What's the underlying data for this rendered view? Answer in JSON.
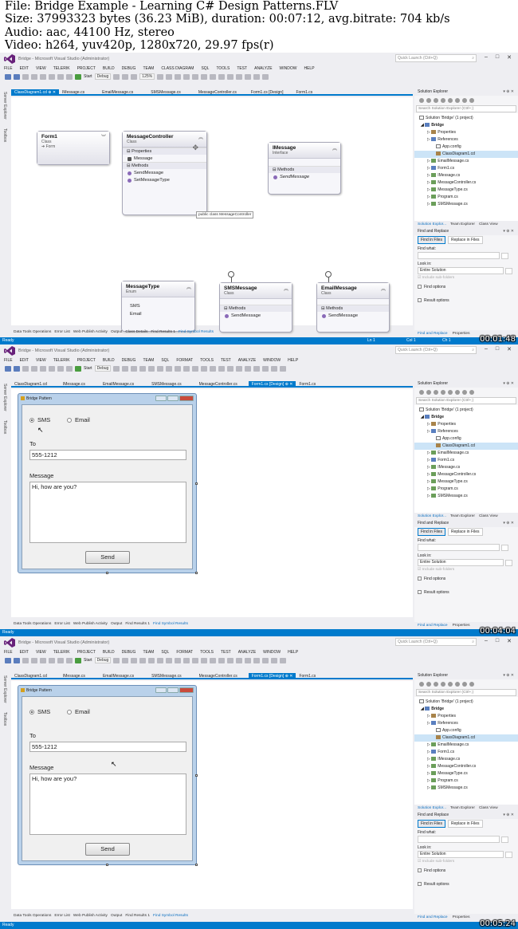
{
  "info": {
    "file": "File: Bridge Example - Learning C# Design Patterns.FLV",
    "size": "Size: 37993323 bytes (36.23 MiB), duration: 00:07:12, avg.bitrate: 704 kb/s",
    "audio": "Audio: aac, 44100 Hz, stereo",
    "video": "Video: h264, yuv420p, 1280x720, 29.97 fps(r)"
  },
  "colors": {
    "accent": "#007acc",
    "status_bar": "#007acc",
    "editor_bg": "#ffffff"
  },
  "window": {
    "title": "Bridge - Microsoft Visual Studio (Administrator)",
    "quick_launch": "Quick Launch (Ctrl+Q)",
    "menu1": [
      "FILE",
      "EDIT",
      "VIEW",
      "TELERIK",
      "PROJECT",
      "BUILD",
      "DEBUG",
      "TEAM",
      "CLASS DIAGRAM",
      "SQL",
      "TOOLS",
      "TEST",
      "ANALYZE",
      "WINDOW",
      "HELP"
    ],
    "menu2": [
      "FILE",
      "EDIT",
      "VIEW",
      "TELERIK",
      "PROJECT",
      "BUILD",
      "DEBUG",
      "TEAM",
      "SQL",
      "FORMAT",
      "TOOLS",
      "TEST",
      "ANALYZE",
      "WINDOW",
      "HELP"
    ],
    "start": "Start",
    "config": "Debug",
    "zoom": "125%",
    "left_tabs": [
      "Server Explorer",
      "Toolbox"
    ]
  },
  "frame1": {
    "tabs": [
      "ClassDiagram1.cd",
      "IMessage.cs",
      "EmailMessage.cs",
      "SMSMessage.cs",
      "MessageController.cs",
      "Form1.cs [Design]",
      "Form1.cs"
    ],
    "status": "Ready",
    "ln": "Ln 1",
    "col": "Col 1",
    "ch": "Ch 1",
    "timestamp": "00:01:48"
  },
  "frame2": {
    "tabs": [
      "ClassDiagram1.cd",
      "IMessage.cs",
      "EmailMessage.cs",
      "SMSMessage.cs",
      "MessageController.cs",
      "Form1.cs [Design]",
      "Form1.cs"
    ],
    "status": "Ready",
    "timestamp": "00:04:04"
  },
  "frame3": {
    "tabs": [
      "ClassDiagram1.cd",
      "IMessage.cs",
      "EmailMessage.cs",
      "SMSMessage.cs",
      "MessageController.cs",
      "Form1.cs [Design]",
      "Form1.cs"
    ],
    "status": "Ready",
    "timestamp": "00:05:24"
  },
  "diagram": {
    "form1": {
      "name": "Form1",
      "stereo": "Class",
      "base": "Form"
    },
    "controller": {
      "name": "MessageController",
      "stereo": "Class",
      "props_label": "Properties",
      "prop": "Message",
      "methods_label": "Methods",
      "m1": "SendMessage",
      "m2": "SetMessageType",
      "tooltip": "public class MessageController"
    },
    "imessage": {
      "name": "IMessage",
      "stereo": "Interface",
      "methods_label": "Methods",
      "m1": "SendMessage"
    },
    "msgtype": {
      "name": "MessageType",
      "stereo": "Enum",
      "v1": "SMS",
      "v2": "Email"
    },
    "sms": {
      "name": "SMSMessage",
      "stereo": "Class",
      "methods_label": "Methods",
      "m1": "SendMessage"
    },
    "email": {
      "name": "EmailMessage",
      "stereo": "Class",
      "methods_label": "Methods",
      "m1": "SendMessage"
    }
  },
  "form": {
    "title": "Bridge Pattern",
    "sms": "SMS",
    "email": "Email",
    "to_label": "To",
    "to_value": "555-1212",
    "message_label": "Message",
    "message_value": "Hi, how are you?",
    "send": "Send"
  },
  "bottom_tabs": [
    "Data Tools Operations",
    "Error List",
    "Web Publish Activity",
    "Output",
    "Class Details",
    "Find Results 1",
    "Find Symbol Results"
  ],
  "bottom_tabs2": [
    "Data Tools Operations",
    "Error List",
    "Web Publish Activity",
    "Output",
    "Find Results 1",
    "Find Symbol Results"
  ],
  "solution": {
    "header": "Solution Explorer",
    "search": "Search Solution Explorer (Ctrl+;)",
    "items": [
      "Solution 'Bridge' (1 project)",
      "Bridge",
      "Properties",
      "References",
      "App.config",
      "ClassDiagram1.cd",
      "EmailMessage.cs",
      "Form1.cs",
      "IMessage.cs",
      "MessageController.cs",
      "MessageType.cs",
      "Program.cs",
      "SMSMessage.cs"
    ],
    "tabs": [
      "Solution Explor...",
      "Team Explorer",
      "Class View"
    ]
  },
  "find": {
    "header": "Find and Replace",
    "find_in_files": "Find in Files",
    "replace_in_files": "Replace in Files",
    "find_what": "Find what:",
    "look_in": "Look in:",
    "look_in_value": "Entire Solution",
    "include_sub": "Include sub-folders",
    "find_options": "Find options",
    "result_options": "Result options",
    "footer": [
      "Find and Replace",
      "Properties"
    ]
  }
}
